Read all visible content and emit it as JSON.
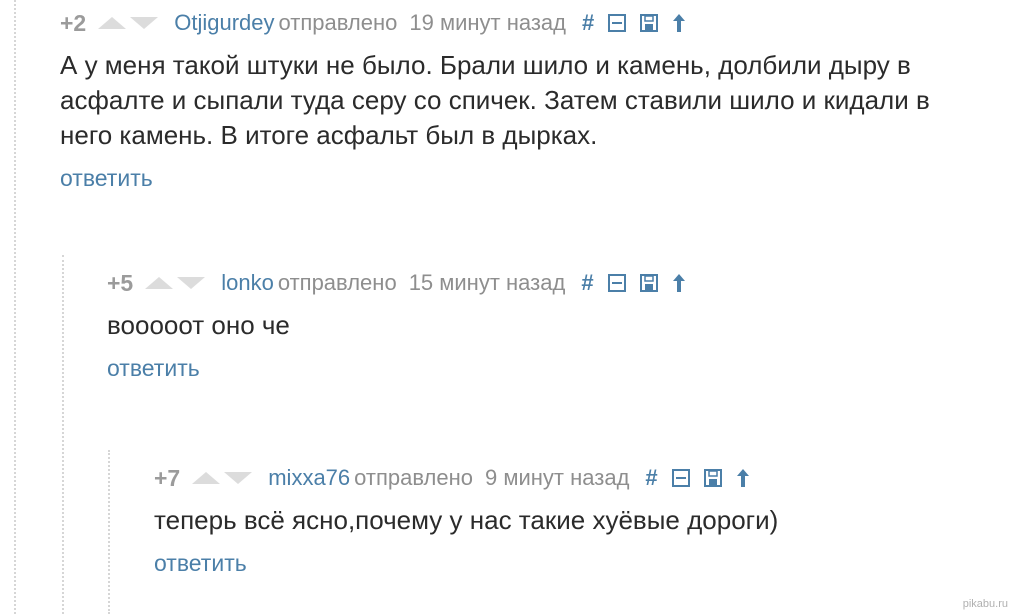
{
  "comments": [
    {
      "rating": "+2",
      "author": "Otjigurdey",
      "sent_label": "отправлено",
      "time": "19 минут назад",
      "body_lines": [
        "А у меня такой штуки не было. Брали шило и камень, долбили дыру в",
        "асфалте и сыпали туда серу со спичек. Затем ставили шило и кидали в",
        "него камень. В итоге асфальт был в дырках."
      ],
      "reply_label": "ответить",
      "hash_label": "#"
    },
    {
      "rating": "+5",
      "author": "lonko",
      "sent_label": "отправлено",
      "time": "15 минут назад",
      "body_lines": [
        "вооооот оно че"
      ],
      "reply_label": "ответить",
      "hash_label": "#"
    },
    {
      "rating": "+7",
      "author": "mixxa76",
      "sent_label": "отправлено",
      "time": "9 минут назад",
      "body_lines": [
        "теперь всё ясно,почему у нас такие хуёвые дороги)"
      ],
      "reply_label": "ответить",
      "hash_label": "#"
    }
  ],
  "icons": [
    "upvote-icon",
    "downvote-icon",
    "collapse-icon",
    "save-icon",
    "parent-arrow-icon"
  ],
  "colors": {
    "link": "#4b7fa8",
    "meta": "#8e8e8e",
    "text": "#2b2b2b",
    "vote": "#dcdcdc"
  },
  "watermark": "pikabu.ru"
}
